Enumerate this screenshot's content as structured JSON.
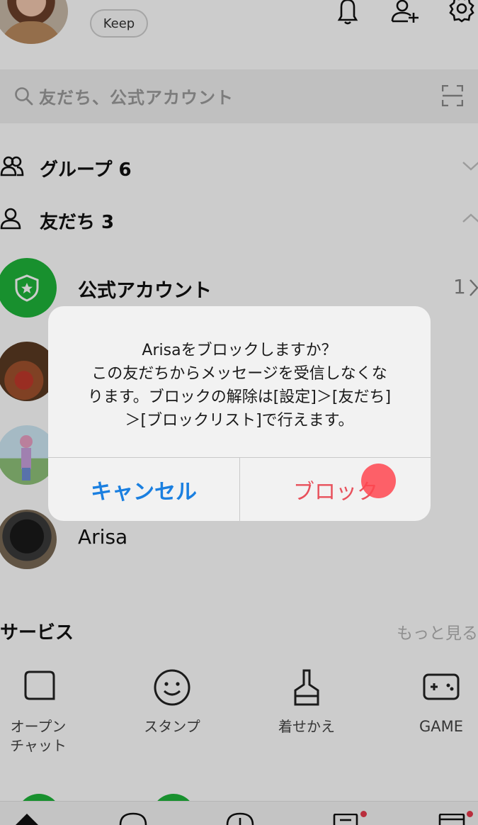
{
  "header": {
    "keep_label": "Keep"
  },
  "search": {
    "placeholder": "友だち、公式アカウント"
  },
  "sections": {
    "groups": "グループ 6",
    "friends": "友だち 3"
  },
  "friends": {
    "official_label": "公式アカウント",
    "official_count": "1",
    "arisa": "Arisa"
  },
  "services": {
    "title": "サービス",
    "more": "もっと見る",
    "items": [
      {
        "label_line1": "オープン",
        "label_line2": "チャット",
        "icon": "open-chat-icon"
      },
      {
        "label_line1": "スタンプ",
        "label_line2": "",
        "icon": "sticker-icon"
      },
      {
        "label_line1": "着せかえ",
        "label_line2": "",
        "icon": "theme-icon"
      },
      {
        "label_line1": "GAME",
        "label_line2": "",
        "icon": "game-icon"
      }
    ]
  },
  "dialog": {
    "line1": "Arisaをブロックしますか？",
    "line2": "この友だちからメッセージを受信しなくな",
    "line3": "ります。ブロックの解除は[設定]＞[友だち]",
    "line4": "＞[ブロックリスト]で行えます。",
    "cancel": "キャンセル",
    "block": "ブロック"
  },
  "colors": {
    "cancel": "#1a7fe0",
    "block": "#e8505b",
    "line_green": "#06c755"
  }
}
